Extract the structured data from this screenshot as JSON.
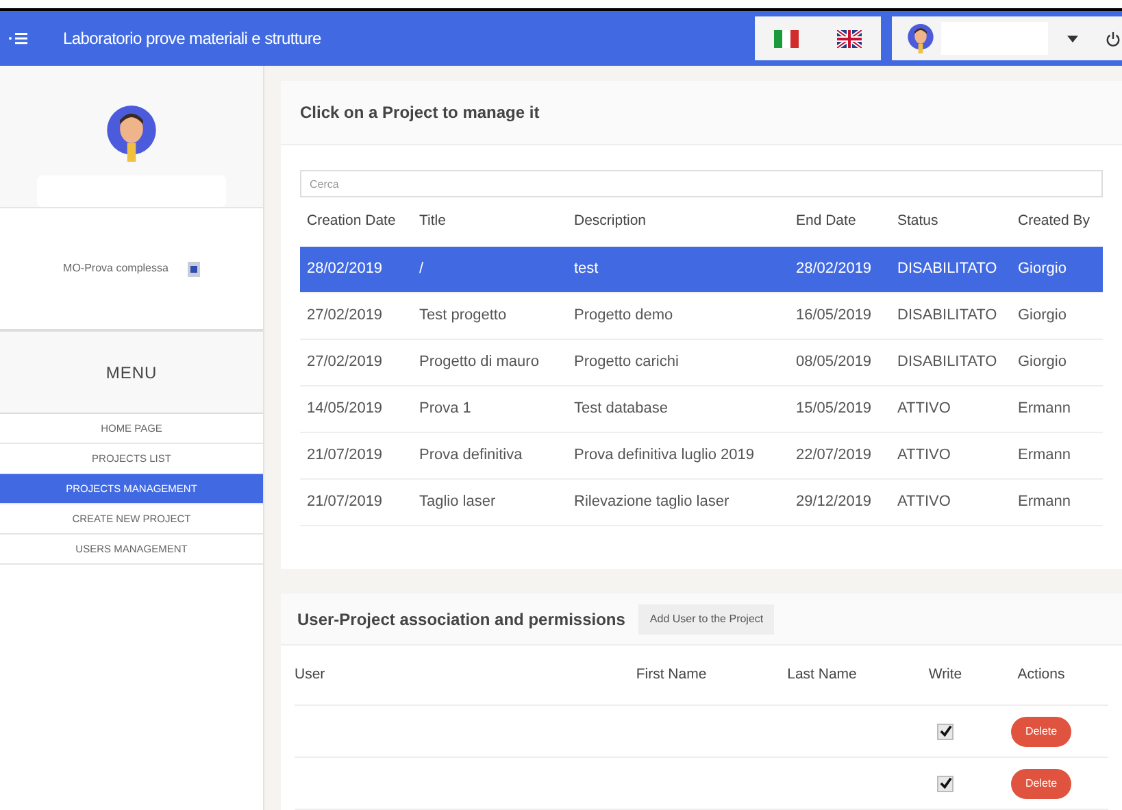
{
  "header": {
    "title": "Laboratorio prove materiali e strutture"
  },
  "sidebar": {
    "project": "MO-Prova complessa",
    "menu_title": "MENU",
    "items": [
      {
        "label": "HOME PAGE",
        "selected": false
      },
      {
        "label": "PROJECTS LIST",
        "selected": false
      },
      {
        "label": "PROJECTS MANAGEMENT",
        "selected": true
      },
      {
        "label": "CREATE NEW PROJECT",
        "selected": false
      },
      {
        "label": "USERS MANAGEMENT",
        "selected": false
      }
    ]
  },
  "projects": {
    "title": "Click on a Project to manage it",
    "search": {
      "placeholder": "Cerca"
    },
    "columns": [
      "Creation Date",
      "Title",
      "Description",
      "End Date",
      "Status",
      "Created By"
    ],
    "rows": [
      {
        "cells": [
          "28/02/2019",
          "/",
          "test",
          "28/02/2019",
          "DISABILITATO",
          "Giorgio"
        ],
        "selected": true
      },
      {
        "cells": [
          "27/02/2019",
          "Test progetto",
          "Progetto demo",
          "16/05/2019",
          "DISABILITATO",
          "Giorgio"
        ],
        "selected": false
      },
      {
        "cells": [
          "27/02/2019",
          "Progetto di mauro",
          "Progetto carichi",
          "08/05/2019",
          "DISABILITATO",
          "Giorgio"
        ],
        "selected": false
      },
      {
        "cells": [
          "14/05/2019",
          "Prova 1",
          "Test database",
          "15/05/2019",
          "ATTIVO",
          "Ermann"
        ],
        "selected": false
      },
      {
        "cells": [
          "21/07/2019",
          "Prova definitiva",
          "Prova definitiva luglio 2019",
          "22/07/2019",
          "ATTIVO",
          "Ermann"
        ],
        "selected": false
      },
      {
        "cells": [
          "21/07/2019",
          "Taglio laser",
          "Rilevazione taglio laser",
          "29/12/2019",
          "ATTIVO",
          "Ermann"
        ],
        "selected": false
      }
    ]
  },
  "permissions": {
    "title": "User-Project association and permissions",
    "add_button": "Add User to the Project",
    "columns": [
      "User",
      "First Name",
      "Last Name",
      "Write",
      "Actions"
    ],
    "rows": [
      {
        "write": true,
        "action": "Delete"
      },
      {
        "write": true,
        "action": "Delete"
      }
    ]
  }
}
